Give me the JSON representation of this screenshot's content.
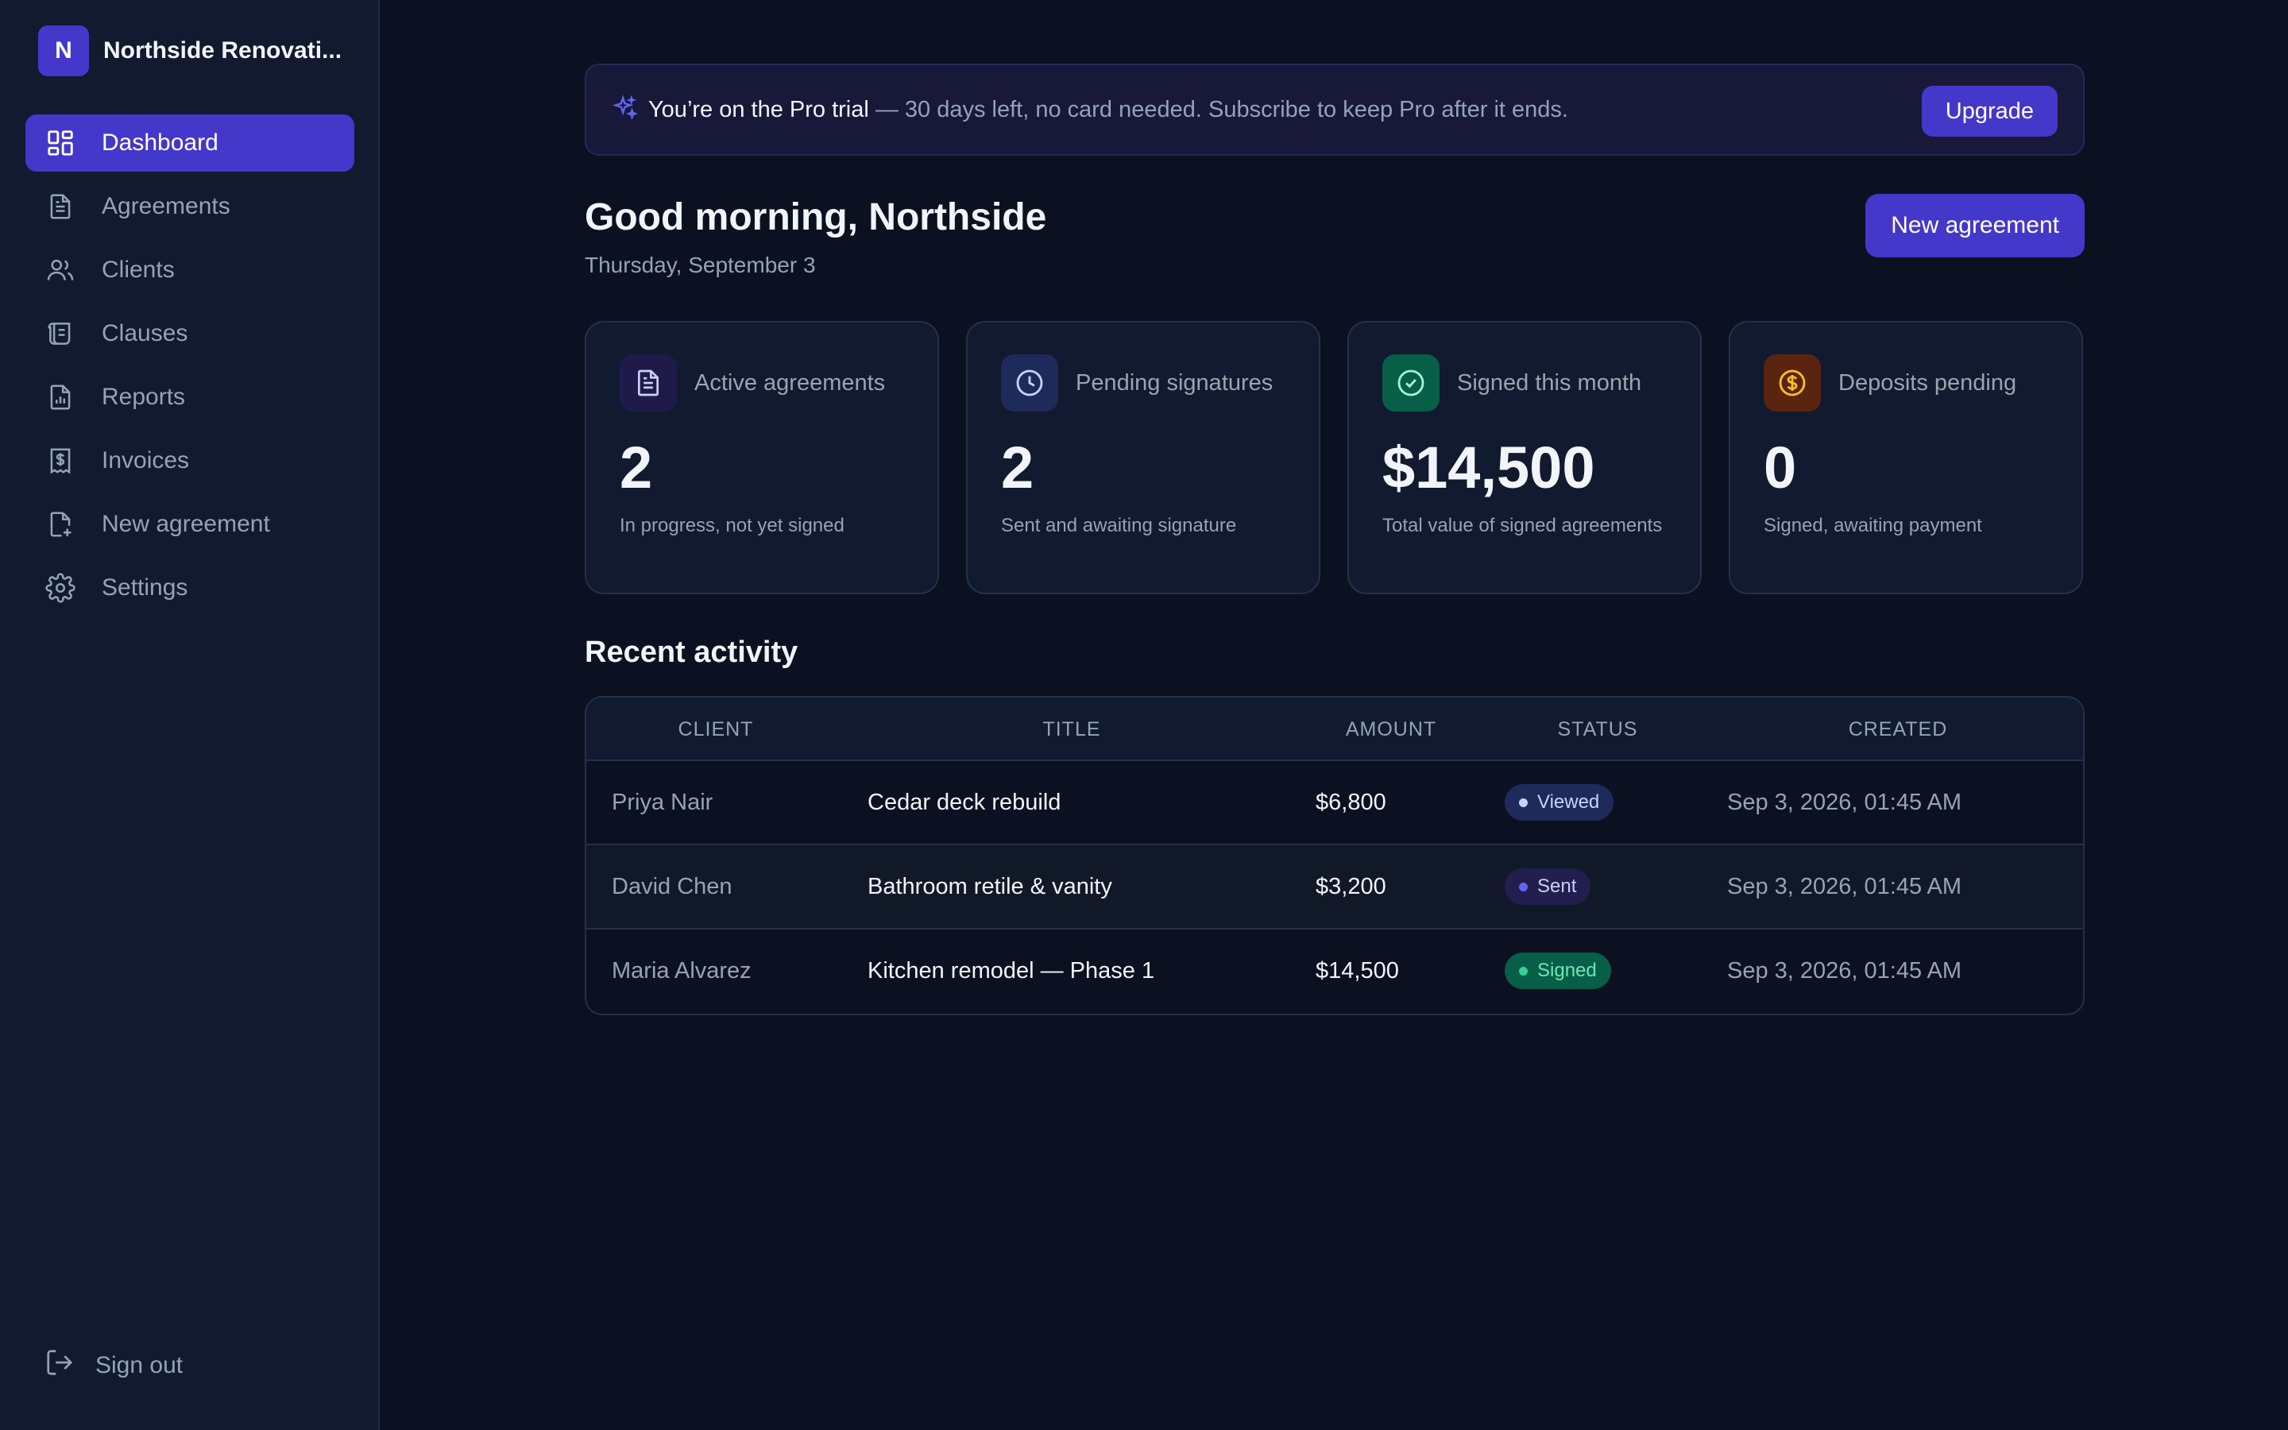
{
  "brand": {
    "initial": "N",
    "name": "Northside Renovati..."
  },
  "nav": [
    {
      "label": "Dashboard",
      "icon": "dashboard-icon",
      "active": true
    },
    {
      "label": "Agreements",
      "icon": "document-icon"
    },
    {
      "label": "Clients",
      "icon": "users-icon"
    },
    {
      "label": "Clauses",
      "icon": "scroll-icon"
    },
    {
      "label": "Reports",
      "icon": "report-icon"
    },
    {
      "label": "Invoices",
      "icon": "receipt-icon"
    },
    {
      "label": "New agreement",
      "icon": "file-plus-icon"
    },
    {
      "label": "Settings",
      "icon": "gear-icon"
    }
  ],
  "signout": {
    "label": "Sign out"
  },
  "trial": {
    "title": "You’re on the Pro trial",
    "message": "— 30 days left, no card needed. Subscribe to keep Pro after it ends.",
    "button": "Upgrade"
  },
  "header": {
    "greeting": "Good morning, Northside",
    "date": "Thursday, September 3",
    "new_button": "New agreement"
  },
  "cards": [
    {
      "title": "Active agreements",
      "value": "2",
      "sub": "In progress, not yet signed",
      "icon": "document-icon",
      "bg": "#1e1b4b",
      "fg": "#c7d2fe"
    },
    {
      "title": "Pending signatures",
      "value": "2",
      "sub": "Sent and awaiting signature",
      "icon": "clock-icon",
      "bg": "#1e2a5a",
      "fg": "#c7d2fe"
    },
    {
      "title": "Signed this month",
      "value": "$14,500",
      "sub": "Total value of signed agreements",
      "icon": "check-circle-icon",
      "bg": "#065f46",
      "fg": "#a7f3d0"
    },
    {
      "title": "Deposits pending",
      "value": "0",
      "sub": "Signed, awaiting payment",
      "icon": "dollar-icon",
      "bg": "#5a2410",
      "fg": "#fbbf24"
    }
  ],
  "activity": {
    "title": "Recent activity",
    "columns": [
      "CLIENT",
      "TITLE",
      "AMOUNT",
      "STATUS",
      "CREATED"
    ],
    "rows": [
      {
        "client": "Priya Nair",
        "title": "Cedar deck rebuild",
        "amount": "$6,800",
        "status": "Viewed",
        "created": "Sep 3, 2026, 01:45 AM"
      },
      {
        "client": "David Chen",
        "title": "Bathroom retile & vanity",
        "amount": "$3,200",
        "status": "Sent",
        "created": "Sep 3, 2026, 01:45 AM"
      },
      {
        "client": "Maria Alvarez",
        "title": "Kitchen remodel — Phase 1",
        "amount": "$14,500",
        "status": "Signed",
        "created": "Sep 3, 2026, 01:45 AM"
      }
    ]
  },
  "status_colors": {
    "Viewed": {
      "bg": "#1e2a5a",
      "fg": "#c7d2fe",
      "dot": "#c7d2fe"
    },
    "Sent": {
      "bg": "#221f4e",
      "fg": "#c7d2fe",
      "dot": "#6366f1"
    },
    "Signed": {
      "bg": "#065f46",
      "fg": "#6ee7b7",
      "dot": "#34d399"
    }
  }
}
